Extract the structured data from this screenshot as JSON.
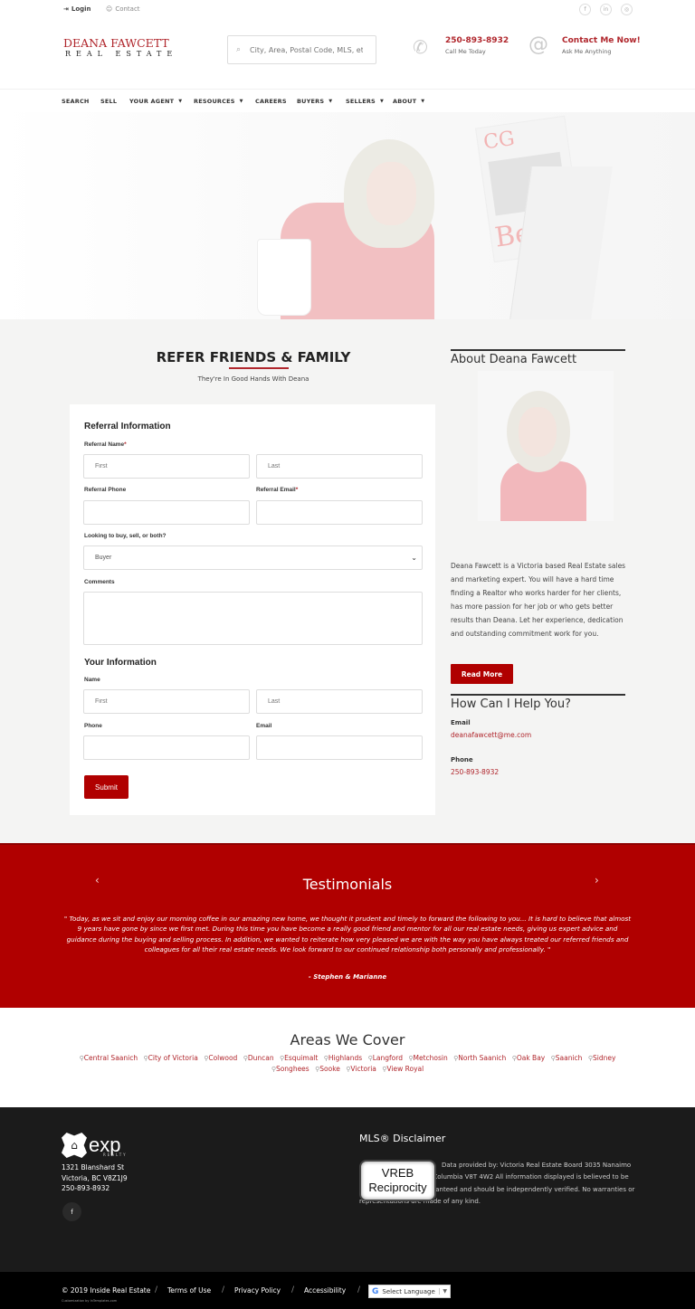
{
  "utility_bar": {
    "login_label": "Login",
    "contact_label": "Contact",
    "social_icons": [
      "facebook-icon",
      "linkedin-icon",
      "instagram-icon"
    ],
    "social_glyphs": [
      "f",
      "in",
      "◎"
    ]
  },
  "header": {
    "logo_main": "DEANA FAWCETT",
    "logo_sub": "REAL ESTATE",
    "search_placeholder": "City, Area, Postal Code, MLS, etc.",
    "phone_number": "250-893-8932",
    "phone_sub": "Call Me Today",
    "contact_title": "Contact Me Now!",
    "contact_sub": "Ask Me Anything"
  },
  "nav": {
    "items": [
      {
        "label": "SEARCH",
        "dropdown": false
      },
      {
        "label": "SELL",
        "dropdown": false
      },
      {
        "label": "YOUR AGENT",
        "dropdown": true
      },
      {
        "label": "RESOURCES",
        "dropdown": true
      },
      {
        "label": "CAREERS",
        "dropdown": false
      },
      {
        "label": "BUYERS",
        "dropdown": true
      },
      {
        "label": "SELLERS",
        "dropdown": true
      },
      {
        "label": "ABOUT",
        "dropdown": true
      }
    ]
  },
  "hero": {
    "magazine_title": "CG",
    "magazine_word": "Be"
  },
  "referral": {
    "title": "REFER FRIENDS & FAMILY",
    "subtitle": "They're In Good Hands With Deana",
    "section1_heading": "Referral Information",
    "referral_name_label": "Referral Name",
    "first_placeholder": "First",
    "last_placeholder": "Last",
    "referral_phone_label": "Referral Phone",
    "referral_email_label": "Referral Email",
    "required_mark": "*",
    "buy_sell_label": "Looking to buy, sell, or both?",
    "buy_sell_value": "Buyer",
    "comments_label": "Comments",
    "section2_heading": "Your Information",
    "name_label": "Name",
    "phone_label": "Phone",
    "email_label": "Email",
    "submit_label": "Submit"
  },
  "sidebar": {
    "about_heading": "About Deana Fawcett",
    "about_text": "Deana Fawcett is a Victoria based Real Estate sales and marketing expert. You will have a hard time finding a Realtor who works harder for her clients, has more passion for her job or who gets better results than Deana. Let her experience, dedication and outstanding commitment work for you.",
    "read_more_label": "Read More",
    "help_heading": "How Can I Help You?",
    "email_label": "Email",
    "email_value": "deanafawcett@me.com",
    "phone_label": "Phone",
    "phone_value": "250-893-8932"
  },
  "testimonials": {
    "title": "Testimonials",
    "prev_arrow": "‹",
    "next_arrow": "›",
    "quote": "\" Today, as we sit and enjoy our morning coffee in our amazing new home, we thought it prudent and timely to forward the following to you... It is hard to believe that almost 9 years have gone by since we first met. During this time you have become a really good friend and mentor for all our real estate needs, giving us expert advice and guidance during the buying and selling process. In addition, we wanted to reiterate how very pleased we are with the way you have always treated our referred friends and colleagues for all their real estate needs. We look forward to our continued relationship both personally and professionally. \"",
    "author": "- Stephen & Marianne"
  },
  "areas": {
    "title": "Areas We Cover",
    "list": [
      "Central Saanich",
      "City of Victoria",
      "Colwood",
      "Duncan",
      "Esquimalt",
      "Highlands",
      "Langford",
      "Metchosin",
      "North Saanich",
      "Oak Bay",
      "Saanich",
      "Sidney",
      "Songhees",
      "Sooke",
      "Victoria",
      "View Royal"
    ]
  },
  "footer": {
    "brand": "exp",
    "brand_sub": "REALTY",
    "address_line1": "1321 Blanshard St",
    "address_line2": "Victoria, BC V8Z1J9",
    "phone": "250-893-8932",
    "facebook_glyph": "f",
    "mls_title": "MLS® Disclaimer",
    "vreb_line1": "VREB",
    "vreb_line2": "Reciprocity",
    "mls_text": "Data provided by: Victoria Real Estate Board 3035 Nanaimo Street, Victoria, British Columbia V8T 4W2 All information displayed is believed to be accurate but is not guaranteed and should be independently verified. No warranties or representations are made of any kind.",
    "copyright": "© 2019 Inside Real Estate",
    "terms_label": "Terms of Use",
    "privacy_label": "Privacy Policy",
    "accessibility_label": "Accessibility",
    "separator": "/",
    "customization": "Customization by InTemplates.com",
    "language_label": "Select Language",
    "language_caret": "▼"
  },
  "colors": {
    "brand_red": "#b00000",
    "accent_red": "#b0262c",
    "footer_dark": "#1b1b1b"
  }
}
